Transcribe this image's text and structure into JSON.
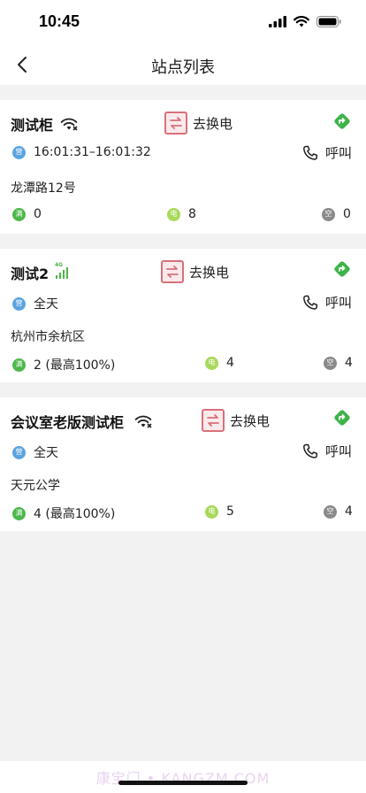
{
  "status_bar": {
    "time": "10:45"
  },
  "nav": {
    "title": "站点列表"
  },
  "stations": [
    {
      "name": "测试柜",
      "signal": "wifi",
      "swap_label": "去换电",
      "hours": "16:01:31–16:01:32",
      "call_label": "呼叫",
      "address": "龙潭路12号",
      "full": "0",
      "charging": "8",
      "empty": "0",
      "badges": {
        "hours": "营",
        "full": "满",
        "charging": "电",
        "empty": "空"
      }
    },
    {
      "name": "测试2",
      "signal": "4G",
      "swap_label": "去换电",
      "hours": "全天",
      "call_label": "呼叫",
      "address": "杭州市余杭区",
      "full": "2 (最高100%)",
      "charging": "4",
      "empty": "4",
      "badges": {
        "hours": "营",
        "full": "满",
        "charging": "电",
        "empty": "空"
      }
    },
    {
      "name": "会议室老版测试柜",
      "signal": "wifi",
      "swap_label": "去换电",
      "hours": "全天",
      "call_label": "呼叫",
      "address": "天元公学",
      "full": "4 (最高100%)",
      "charging": "5",
      "empty": "4",
      "badges": {
        "hours": "营",
        "full": "满",
        "charging": "电",
        "empty": "空"
      }
    }
  ],
  "signal_4g_label": "4G",
  "watermark": "康宝门 • KANGZM.COM",
  "colors": {
    "swap_red": "#d9707a",
    "badge_blue": "#5ba4e0",
    "badge_green": "#4db84a",
    "badge_lime": "#a8d95a",
    "badge_gray": "#8a8a8a",
    "nav_green": "#3fb34a"
  }
}
